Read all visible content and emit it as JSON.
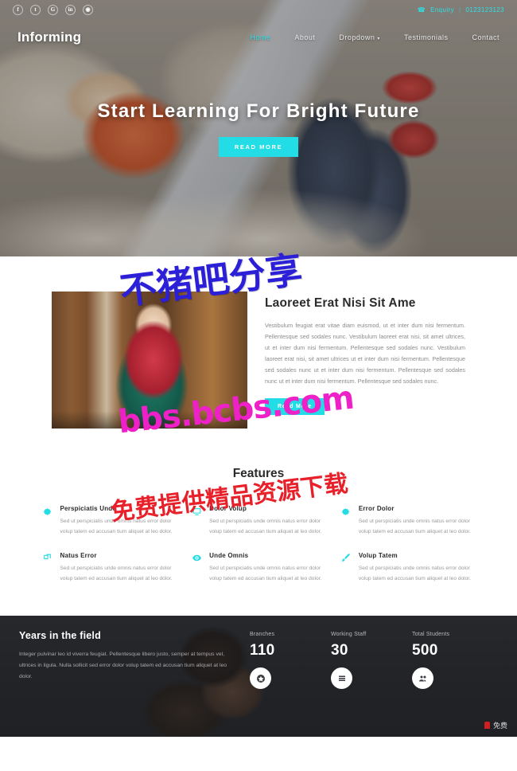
{
  "header": {
    "logo": "Informing",
    "socials": [
      {
        "name": "facebook-icon",
        "glyph": "f"
      },
      {
        "name": "twitter-icon",
        "glyph": "t"
      },
      {
        "name": "google-plus-icon",
        "glyph": "G"
      },
      {
        "name": "linkedin-icon",
        "glyph": "in"
      },
      {
        "name": "instagram-icon",
        "glyph": "◉"
      }
    ],
    "enquiry_label": "Enquiry",
    "enquiry_phone": "0123123123",
    "phone_icon": "☎",
    "separator": "|",
    "menu": [
      {
        "label": "Home",
        "active": true
      },
      {
        "label": "About",
        "active": false
      },
      {
        "label": "Dropdown",
        "active": false,
        "caret": "▾"
      },
      {
        "label": "Testimonials",
        "active": false
      },
      {
        "label": "Contact",
        "active": false
      }
    ]
  },
  "hero": {
    "title": "Start Learning For Bright Future",
    "button": "READ MORE"
  },
  "about": {
    "title": "Laoreet Erat Nisi Sit Ame",
    "paragraph": "Vestibulum feugiat erat vitae diam euismod, ut et inter dum nisi fermentum. Pellentesque sed sodales nunc. Vestibulum laoreet erat nisi, sit amet ultrices, ut et inter dum nisi fermentum. Pellentesque sed sodales nunc. Vestibulum laoreet erat nisi, sit amet ultrices ut et inter dum nisi fermentum. Pellentesque sed sodales nunc ut et inter dum nisi fermentum. Pellentesque sed sodales nunc ut et inter dum nisi fermentum. Pellentesque sed sodales nunc.",
    "button": "Read More"
  },
  "features": {
    "heading": "Features",
    "items": [
      {
        "icon": "gear-icon",
        "title": "Perspiciatis Unde",
        "text": "Sed ut perspiciatis unde omnis natus error dolor volup tatem ed accusan tium aliquet at leo dolor."
      },
      {
        "icon": "monitor-icon",
        "title": "Dolor Volup",
        "text": "Sed ut perspiciatis unde omnis natus error dolor volup tatem ed accusan tium aliquet at leo dolor."
      },
      {
        "icon": "gear-icon",
        "title": "Error Dolor",
        "text": "Sed ut perspiciatis unde omnis natus error dolor volup tatem ed accusan tium aliquet at leo dolor."
      },
      {
        "icon": "layers-icon",
        "title": "Natus Error",
        "text": "Sed ut perspiciatis unde omnis natus error dolor volup tatem ed accusan tium aliquet at leo dolor."
      },
      {
        "icon": "eye-icon",
        "title": "Unde Omnis",
        "text": "Sed ut perspiciatis unde omnis natus error dolor volup tatem ed accusan tium aliquet at leo dolor."
      },
      {
        "icon": "brush-icon",
        "title": "Volup Tatem",
        "text": "Sed ut perspiciatis unde omnis natus error dolor volup tatem ed accusan tium aliquet at leo dolor."
      }
    ]
  },
  "stats": {
    "title": "Years in the field",
    "paragraph": "Integer pulvinar leo id viverra feugiat. Pellentesque libero justo, semper at tempus vel, ultrices in ligula. Nulla sollicit sed error dolor volup tatem ed accusan tium aliquet at leo dolor.",
    "counters": [
      {
        "label": "Branches",
        "value": "110",
        "icon": "badge-icon"
      },
      {
        "label": "Working Staff",
        "value": "30",
        "icon": "list-icon"
      },
      {
        "label": "Total Students",
        "value": "500",
        "icon": "group-icon"
      }
    ]
  },
  "watermarks": {
    "one": "不猪吧分享",
    "two": "bbs.bcbs.com",
    "three": "免费提供精品资源下载",
    "corner": "免费"
  },
  "colors": {
    "accent": "#22dce6",
    "dark": "#2c2d31",
    "text": "#2b2b2b",
    "muted": "#9a9a9a"
  }
}
